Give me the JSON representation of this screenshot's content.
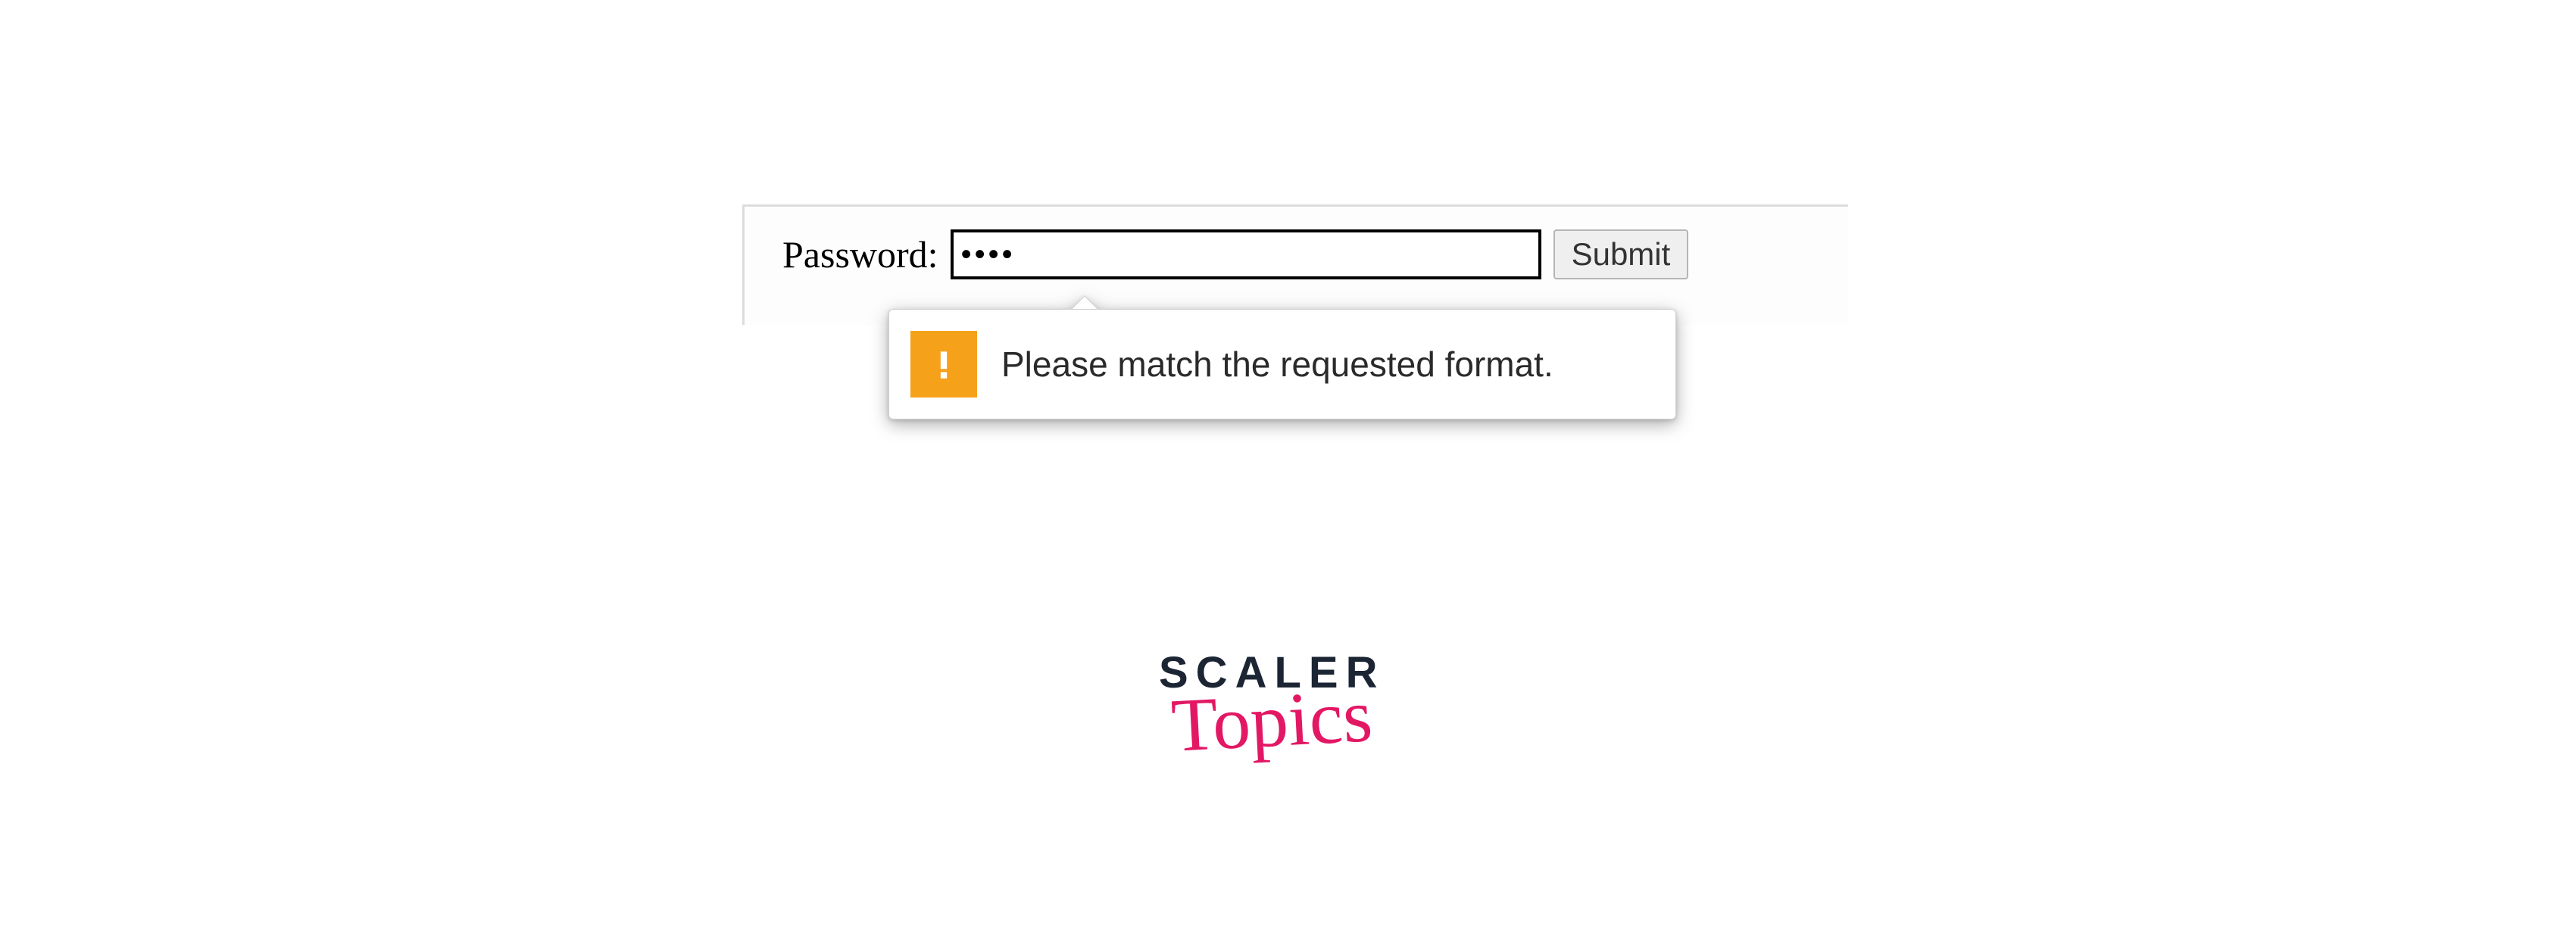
{
  "form": {
    "password_label": "Password:",
    "password_value": "••••",
    "submit_label": "Submit"
  },
  "tooltip": {
    "message": "Please match the requested format.",
    "icon": "warning-icon"
  },
  "logo": {
    "line1": "SCALER",
    "line2": "Topics"
  },
  "colors": {
    "warning_bg": "#f6a11a",
    "brand_pink": "#e31864",
    "brand_dark": "#1c2533"
  }
}
